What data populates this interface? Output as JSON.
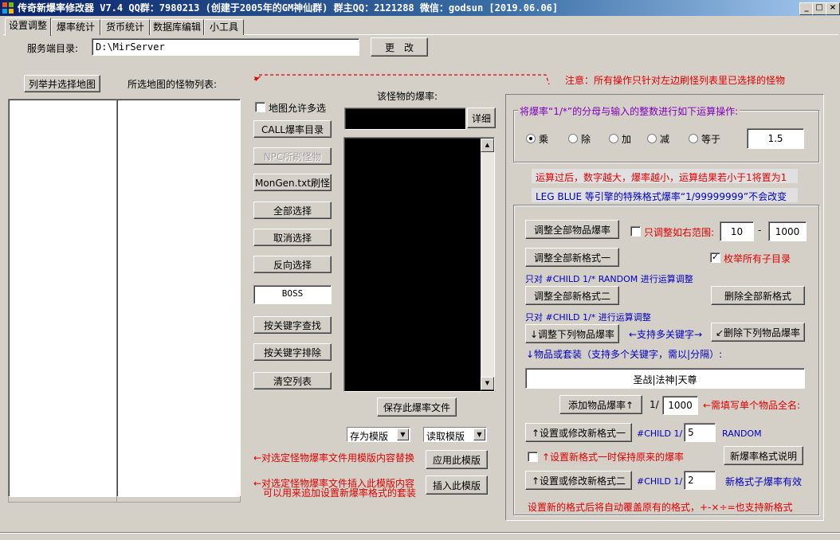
{
  "window": {
    "title": "传奇新爆率修改器 V7.4 QQ群：7980213 (创建于2005年的GM神仙群) 群主QQ：2121288 微信：godsun [2019.06.06]",
    "min": "_",
    "max": "□",
    "close": "×"
  },
  "tabs": [
    "设置调整",
    "爆率统计",
    "货币统计",
    "数据库编辑",
    "小工具"
  ],
  "server": {
    "label": "服务端目录:",
    "value": "D:\\MirServer",
    "change_button": "更　改"
  },
  "left": {
    "list_maps_button": "列举并选择地图",
    "monster_list_label": "所选地图的怪物列表:",
    "allow_multi_label": "地图允许多选"
  },
  "mid_buttons": {
    "call_dir": "CALL爆率目录",
    "npc_spawn": "NPC所刷怪物",
    "mongen": "MonGen.txt刷怪",
    "select_all": "全部选择",
    "deselect": "取消选择",
    "invert": "反向选择",
    "boss_value": "BOSS",
    "keyword_find": "按关键字查找",
    "keyword_exclude": "按关键字排除",
    "clear_list": "清空列表"
  },
  "drop": {
    "label": "该怪物的爆率:",
    "detail_button": "详细",
    "save_button": "保存此爆率文件"
  },
  "template": {
    "save_as": "存为模版",
    "read": "读取模版",
    "apply_note": "←对选定怪物爆率文件用模版内容替换",
    "apply_button": "应用此模版",
    "insert_note_1": "←对选定怪物爆率文件插入此模版内容",
    "insert_note_2": "可以用来追加设置新爆率格式的套装",
    "insert_button": "插入此模版"
  },
  "notice": "注意：所有操作只针对左边刷怪列表里已选择的怪物",
  "calc": {
    "group_title": "将爆率“1/*”的分母与输入的整数进行如下运算操作:",
    "ops": [
      "乘",
      "除",
      "加",
      "减",
      "等于"
    ],
    "selected": "乘",
    "value": "1.5",
    "note1": "运算过后，数字越大，爆率越小，运算结果若小于1将置为1",
    "note2": "LEG BLUE 等引擎的特殊格式爆率“1/99999999”不会改变"
  },
  "adjust": {
    "adjust_all_items": "调整全部物品爆率",
    "range_label": "只调整如右范围:",
    "range_from": "10",
    "range_dash": "-",
    "range_to": "1000",
    "adjust_new_fmt1": "调整全部新格式一",
    "enum_subdirs": "枚举所有子目录",
    "note_fmt1": "只对 #CHILD 1/* RANDOM 进行运算调整",
    "adjust_new_fmt2": "调整全部新格式二",
    "delete_all_new": "删除全部新格式",
    "note_fmt2": "只对 #CHILD 1/* 进行运算调整",
    "adjust_listed": "↓调整下列物品爆率",
    "multi_keyword": "←支持多关键字→",
    "delete_listed": "↙删除下列物品爆率",
    "items_label": "↓物品或套装（支持多个关键字，需以|分隔）:",
    "items_value": "圣战|法神|天尊",
    "add_item_button": "添加物品爆率↑",
    "one_over": "1/",
    "add_value": "1000",
    "add_note": "←需填写单个物品全名:",
    "set_fmt1_button": "↑设置或修改新格式一",
    "child_label1": "#CHILD 1/",
    "fmt1_value": "5",
    "random_label": "RANDOM",
    "keep_note": "↑设置新格式一时保持原来的爆率",
    "fmt_help_button": "新爆率格式说明",
    "set_fmt2_button": "↑设置或修改新格式二",
    "child_label2": "#CHILD 1/",
    "fmt2_value": "2",
    "fmt2_note": "新格式子爆率有效",
    "footer_note": "设置新的格式后将自动覆盖原有的格式，+-×÷=也支持新格式"
  },
  "colors": {
    "red": "#e00000",
    "blue": "#0000c0",
    "purple": "#8000c0",
    "face": "#d4d0c8"
  }
}
